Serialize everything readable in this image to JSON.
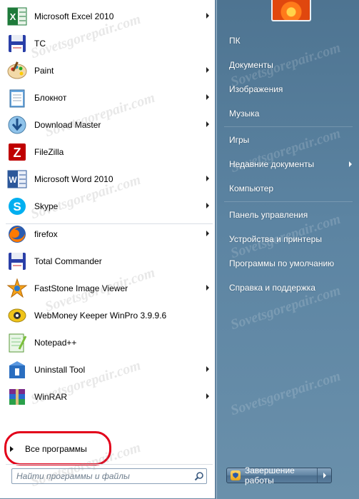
{
  "programs": [
    {
      "label": "Microsoft Excel 2010",
      "icon": "excel-icon",
      "submenu": true
    },
    {
      "label": "TC",
      "icon": "floppy-icon",
      "submenu": false
    },
    {
      "label": "Paint",
      "icon": "paint-icon",
      "submenu": true
    },
    {
      "label": "Блокнот",
      "icon": "notepad-icon",
      "submenu": true
    },
    {
      "label": "Download Master",
      "icon": "download-master-icon",
      "submenu": true
    },
    {
      "label": "FileZilla",
      "icon": "filezilla-icon",
      "submenu": false
    },
    {
      "label": "Microsoft Word 2010",
      "icon": "word-icon",
      "submenu": true
    },
    {
      "label": "Skype",
      "icon": "skype-icon",
      "submenu": true
    },
    {
      "label": "firefox",
      "icon": "firefox-icon",
      "submenu": true
    },
    {
      "label": "Total Commander",
      "icon": "floppy-icon",
      "submenu": false
    },
    {
      "label": "FastStone Image Viewer",
      "icon": "faststone-icon",
      "submenu": true
    },
    {
      "label": "WebMoney Keeper WinPro 3.9.9.6",
      "icon": "webmoney-icon",
      "submenu": false
    },
    {
      "label": "Notepad++",
      "icon": "notepadpp-icon",
      "submenu": false
    },
    {
      "label": "Uninstall Tool",
      "icon": "uninstall-tool-icon",
      "submenu": true
    },
    {
      "label": "WinRAR",
      "icon": "winrar-icon",
      "submenu": true
    }
  ],
  "all_programs": {
    "label": "Все программы"
  },
  "search": {
    "placeholder": "Найти программы и файлы"
  },
  "right_items": [
    {
      "label": "ПК",
      "submenu": false
    },
    {
      "label": "Документы",
      "submenu": false
    },
    {
      "label": "Изображения",
      "submenu": false
    },
    {
      "label": "Музыка",
      "submenu": false
    },
    {
      "label": "Игры",
      "submenu": false
    },
    {
      "label": "Недавние документы",
      "submenu": true
    },
    {
      "label": "Компьютер",
      "submenu": false
    },
    {
      "label": "Панель управления",
      "submenu": false
    },
    {
      "label": "Устройства и принтеры",
      "submenu": false
    },
    {
      "label": "Программы по умолчанию",
      "submenu": false
    },
    {
      "label": "Справка и поддержка",
      "submenu": false
    }
  ],
  "shutdown": {
    "label": "Завершение работы"
  },
  "watermark": "Sovetsgorepair.com",
  "colors": {
    "highlight": "#e2001a",
    "right_panel": "#5a7d9a"
  }
}
